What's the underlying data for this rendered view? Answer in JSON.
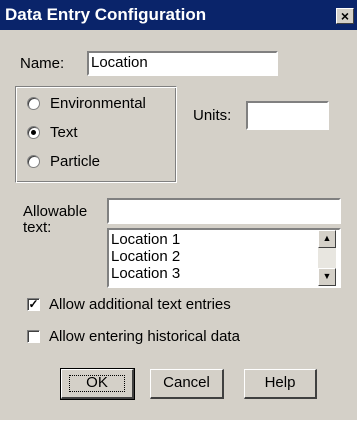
{
  "window": {
    "title": "Data Entry Configuration",
    "close_glyph": "×"
  },
  "name_field": {
    "label": "Name:",
    "value": "Location"
  },
  "type_group": {
    "options": [
      {
        "label": "Environmental",
        "selected": false
      },
      {
        "label": "Text",
        "selected": true
      },
      {
        "label": "Particle",
        "selected": false
      }
    ]
  },
  "units_field": {
    "label": "Units:",
    "value": ""
  },
  "allowable": {
    "label_line1": "Allowable",
    "label_line2": "text:",
    "input_value": "",
    "list_items": [
      "Location 1",
      "Location 2",
      "Location 3"
    ]
  },
  "options": {
    "allow_additional": {
      "label": "Allow additional text entries",
      "checked": true
    },
    "allow_historical": {
      "label": "Allow entering historical data",
      "checked": false
    }
  },
  "buttons": {
    "ok": "OK",
    "cancel": "Cancel",
    "help": "Help"
  },
  "colors": {
    "titlebar": "#0a246a",
    "face": "#d4d0c8"
  },
  "icons": {
    "scroll_up": "▲",
    "scroll_down": "▼",
    "check_mark": "✓"
  }
}
